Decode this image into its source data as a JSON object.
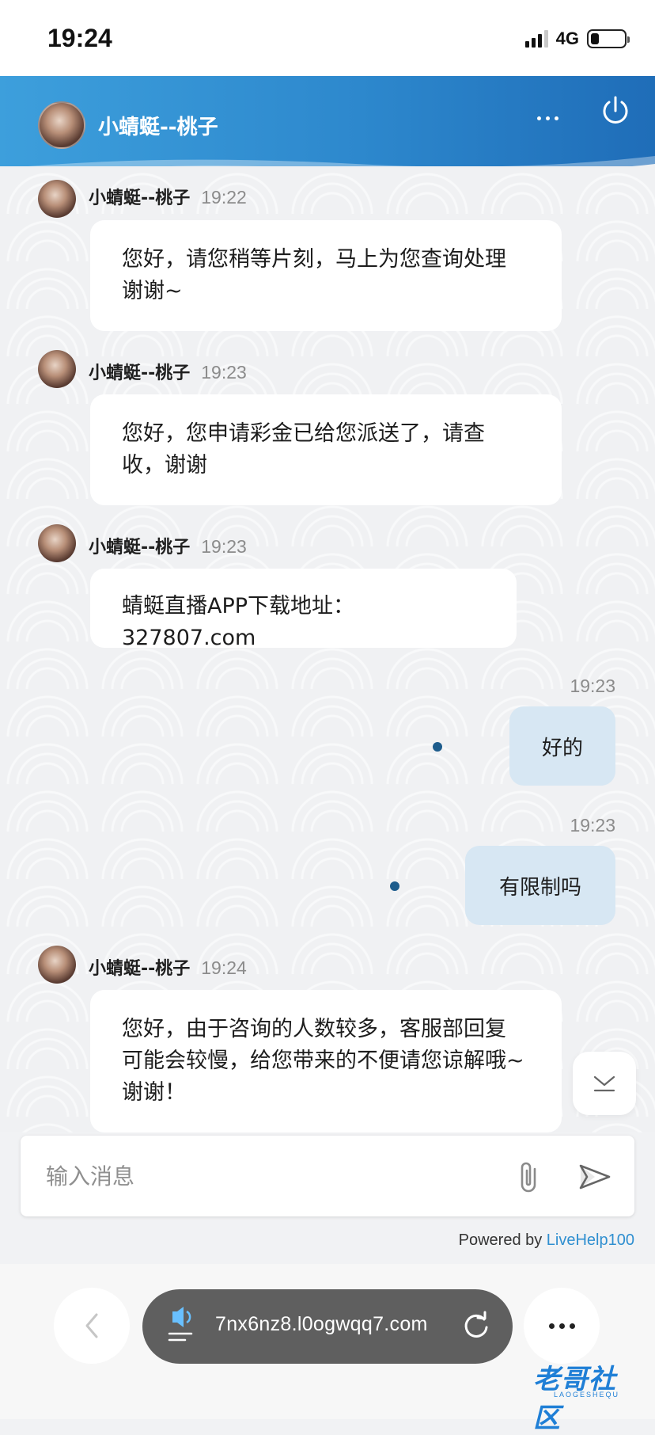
{
  "status_bar": {
    "time": "19:24",
    "network": "4G"
  },
  "header": {
    "agent_name": "小蜻蜓--桃子"
  },
  "messages": [
    {
      "side": "left",
      "name": "小蜻蜓--桃子",
      "time": "19:22",
      "lines": [
        "您好，请您稍等片刻，马上为您查询处理",
        "谢谢~"
      ]
    },
    {
      "side": "left",
      "name": "小蜻蜓--桃子",
      "time": "19:23",
      "lines": [
        "您好，您申请彩金已给您派送了，请查",
        "收，谢谢"
      ]
    },
    {
      "side": "left",
      "name": "小蜻蜓--桃子",
      "time": "19:23",
      "lines": [
        "蜻蜓直播APP下载地址：327807.com"
      ]
    },
    {
      "side": "right",
      "time": "19:23",
      "text": "好的"
    },
    {
      "side": "right",
      "time": "19:23",
      "text": "有限制吗"
    },
    {
      "side": "left",
      "name": "小蜻蜓--桃子",
      "time": "19:24",
      "lines": [
        "您好，由于咨询的人数较多，客服部回复",
        "可能会较慢，给您带来的不便请您谅解哦~",
        "谢谢！"
      ]
    }
  ],
  "input": {
    "placeholder": "输入消息",
    "value": ""
  },
  "footer": {
    "powered_prefix": "Powered by ",
    "powered_link": "LiveHelp100"
  },
  "browser": {
    "url": "7nx6nz8.l0ogwqq7.com"
  },
  "watermark": {
    "text": "老哥社区",
    "sub": "LAOGESHEQU"
  },
  "colors": {
    "header": "#2d88cd",
    "bubble_right": "#d7e7f3",
    "read_dot": "#1d5c8c",
    "link": "#2f8fd0"
  }
}
